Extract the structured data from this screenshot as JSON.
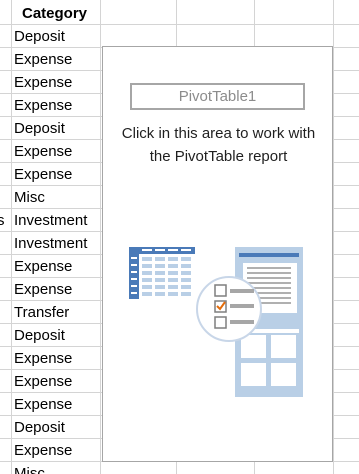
{
  "sheet": {
    "header": "Category",
    "left_fragment": "s",
    "rows": [
      "Deposit",
      "Expense",
      "Expense",
      "Expense",
      "Deposit",
      "Expense",
      "Expense",
      "Misc",
      "Investment",
      "Investment",
      "Expense",
      "Expense",
      "Transfer",
      "Deposit",
      "Expense",
      "Expense",
      "Expense",
      "Deposit",
      "Expense",
      "Misc"
    ]
  },
  "pivot": {
    "name": "PivotTable1",
    "message_line1": "Click in this area to work with",
    "message_line2": "the PivotTable report",
    "illustration_icon": "pivot-table-illustration-icon"
  },
  "colors": {
    "gridline": "#d4d4d4",
    "pivot_border": "#a6a6a6",
    "accent_blue": "#4a7ab8",
    "light_blue": "#b9cfe6",
    "check_orange": "#e46c0a"
  }
}
